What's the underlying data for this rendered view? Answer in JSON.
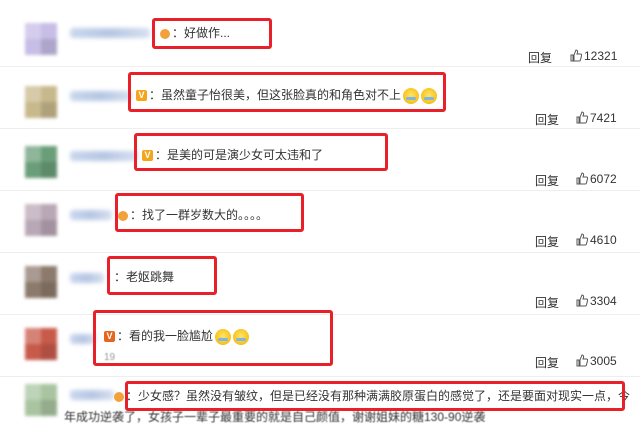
{
  "reply_label": "回复",
  "comments": [
    {
      "avatar_color": "#c7bde6",
      "text": "：好做作...",
      "likes": "12321"
    },
    {
      "avatar_color": "#c8b98d",
      "text": "：虽然童子怡很美，但这张脸真的和角色对不上",
      "likes": "7421"
    },
    {
      "avatar_color": "#6a9e78",
      "text": "：是美的可是演少女可太违和了",
      "likes": "6072"
    },
    {
      "avatar_color": "#b9a7b5",
      "text": "：找了一群岁数大的。。。。",
      "likes": "4610"
    },
    {
      "avatar_color": "#8c7a6c",
      "text": "：老妪跳舞",
      "likes": "3304"
    },
    {
      "avatar_color": "#c85a4a",
      "text": "：看的我一脸尴尬",
      "sub": "19",
      "likes": "3005"
    },
    {
      "avatar_color": "#a9c4a0",
      "text_line1": "：少女感？虽然没有皱纹，但是已经没有那种满满胶原蛋白的感觉了，还是要面对现实一点，今",
      "text_line2": "年成功逆袭了，女孩子一辈子最重要的就是自己颜值，谢谢姐妹的糖130-90逆袭"
    }
  ],
  "colors": {
    "highlight_box": "#e8202a",
    "badge_orange": "#f4a51c"
  }
}
